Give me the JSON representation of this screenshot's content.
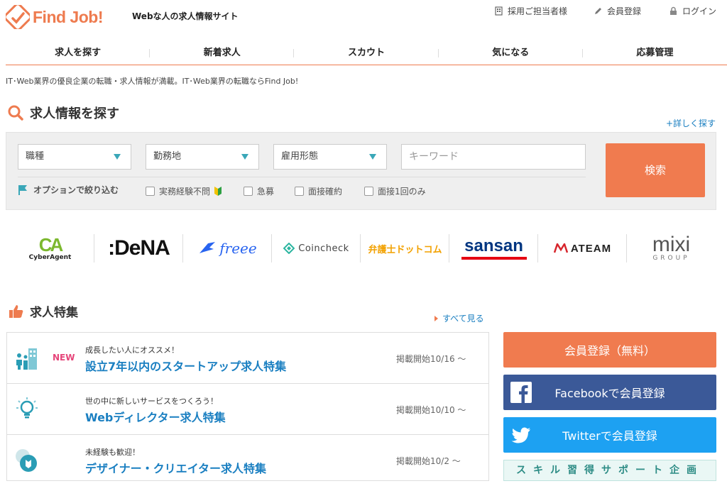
{
  "header": {
    "logo_text": "Find Job!",
    "tagline": "Webな人の求人情報サイト",
    "links": {
      "recruiter": "採用ご担当者様",
      "register": "会員登録",
      "login": "ログイン"
    },
    "icons": {
      "recruiter": "building-icon",
      "register": "pencil-icon",
      "login": "lock-icon"
    }
  },
  "nav": {
    "items": [
      "求人を探す",
      "新着求人",
      "スカウト",
      "気になる",
      "応募管理"
    ]
  },
  "description": "IT･Web業界の優良企業の転職・求人情報が満載。IT･Web業界の転職ならFind Job!",
  "search": {
    "title": "求人情報を探す",
    "detail_link": "+詳しく探す",
    "selects": {
      "job_type": "職種",
      "location": "勤務地",
      "employment": "雇用形態"
    },
    "keyword_placeholder": "キーワード",
    "button": "検索",
    "option_label": "オプションで絞り込む",
    "checkboxes": [
      "実務経験不問",
      "急募",
      "面接確約",
      "面接1回のみ"
    ]
  },
  "companies": [
    {
      "name": "CyberAgent",
      "mark": "CA"
    },
    {
      "name": ":DeNA"
    },
    {
      "name": "freee"
    },
    {
      "name": "Coincheck"
    },
    {
      "name": "弁護士ドットコム"
    },
    {
      "name": "sansan"
    },
    {
      "name": "ATEAM"
    },
    {
      "name": "mixi",
      "sub": "GROUP"
    }
  ],
  "features": {
    "title": "求人特集",
    "see_all": "すべて見る",
    "items": [
      {
        "badge": "NEW",
        "subtitle": "成長したい人にオススメ！",
        "title": "設立7年以内のスタートアップ求人特集",
        "date": "掲載開始10/16 ～",
        "icon": "building-people-icon"
      },
      {
        "badge": "",
        "subtitle": "世の中に新しいサービスをつくろう！",
        "title": "Webディレクター求人特集",
        "date": "掲載開始10/10 ～",
        "icon": "lightbulb-icon"
      },
      {
        "badge": "",
        "subtitle": "未経験も歓迎！",
        "title": "デザイナー・クリエイター求人特集",
        "date": "掲載開始10/2 ～",
        "icon": "beginner-shield-icon"
      }
    ]
  },
  "sidebar": {
    "register_free": "会員登録（無料）",
    "register_facebook": "Facebookで会員登録",
    "register_twitter": "Twitterで会員登録",
    "skill_banner": "スキル習得サポート企画"
  },
  "colors": {
    "brand": "#ee7b4f",
    "link": "#1a7fc1",
    "facebook": "#3b5998",
    "twitter": "#1da1f2",
    "new_badge": "#e6457a"
  }
}
